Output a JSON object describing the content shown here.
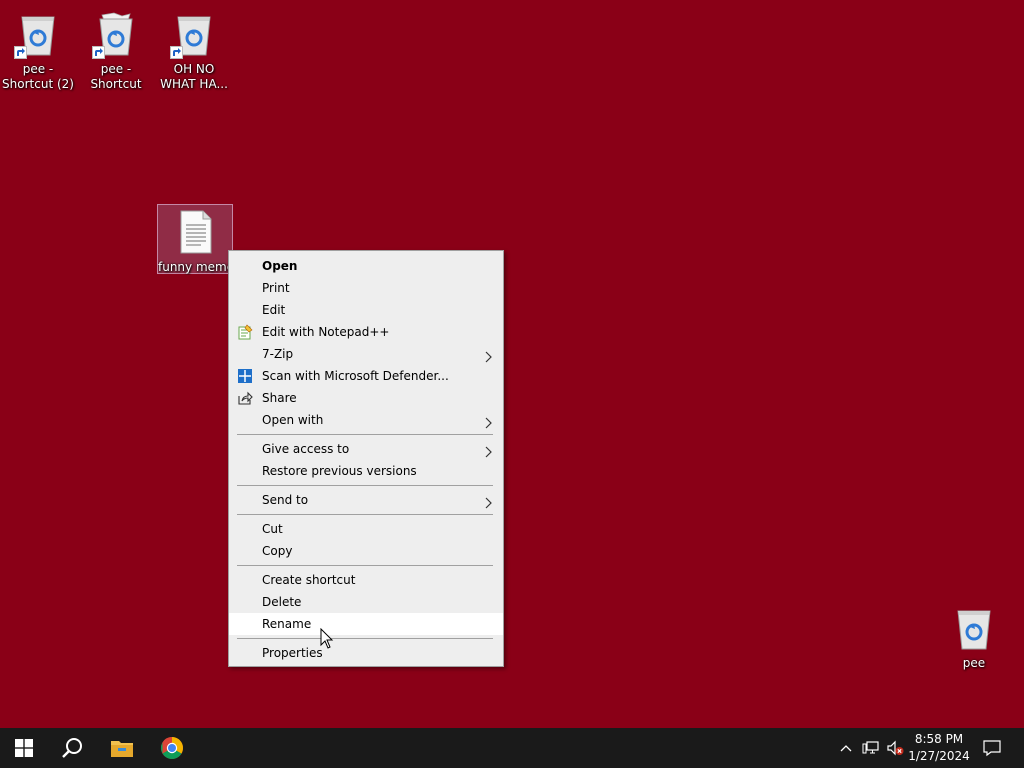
{
  "desktop": {
    "icons": [
      {
        "label": "pee - Shortcut (2)",
        "type": "recycle-bin-empty",
        "shortcut": true
      },
      {
        "label": "pee - Shortcut",
        "type": "recycle-bin-full",
        "shortcut": true
      },
      {
        "label": "OH NO WHAT HA...",
        "type": "recycle-bin-empty",
        "shortcut": true
      },
      {
        "label": "funny meme",
        "type": "text-file",
        "selected": true
      },
      {
        "label": "pee",
        "type": "recycle-bin-empty",
        "shortcut": false
      }
    ]
  },
  "context_menu": {
    "items": {
      "open": "Open",
      "print": "Print",
      "edit": "Edit",
      "edit_notepadpp": "Edit with Notepad++",
      "seven_zip": "7-Zip",
      "scan_defender": "Scan with Microsoft Defender...",
      "share": "Share",
      "open_with": "Open with",
      "give_access": "Give access to",
      "restore_versions": "Restore previous versions",
      "send_to": "Send to",
      "cut": "Cut",
      "copy": "Copy",
      "create_shortcut": "Create shortcut",
      "delete": "Delete",
      "rename": "Rename",
      "properties": "Properties"
    },
    "hovered": "Rename"
  },
  "taskbar": {
    "pinned": [
      "start-button",
      "search-button",
      "file-explorer",
      "chrome"
    ],
    "clock": {
      "time": "8:58 PM",
      "date": "1/27/2024"
    }
  },
  "colors": {
    "desktop_bg": "#8a0017",
    "taskbar_bg": "#1a1a1a",
    "menu_bg": "#eeeeee"
  }
}
